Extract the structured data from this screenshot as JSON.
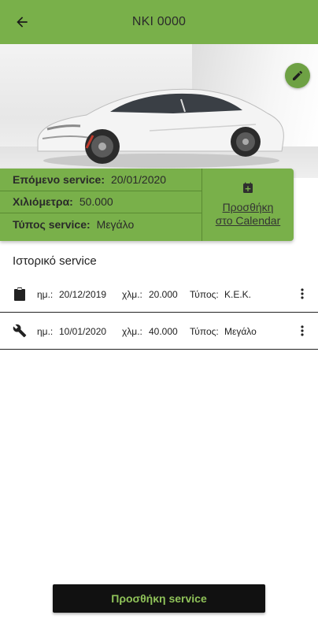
{
  "appbar": {
    "title": "NKI 0000"
  },
  "colors": {
    "accent": "#79b04a",
    "button_bg": "#111111",
    "button_text": "#8fc259"
  },
  "next_service": {
    "date_label": "Επόμενο service:",
    "date_value": "20/01/2020",
    "km_label": "Χιλιόμετρα:",
    "km_value": "50.000",
    "type_label": "Τύπος service:",
    "type_value": "Μεγάλο",
    "calendar_line1": "Προσθήκη",
    "calendar_line2": "στο Calendar"
  },
  "history": {
    "title": "Ιστορικό service",
    "items": [
      {
        "icon": "clipboard-icon",
        "date_label": "ημ.:",
        "date": "20/12/2019",
        "km_label": "χλμ.:",
        "km": "20.000",
        "type_label": "Τύπος:",
        "type": "Κ.Ε.Κ."
      },
      {
        "icon": "wrench-icon",
        "date_label": "ημ.:",
        "date": "10/01/2020",
        "km_label": "χλμ.:",
        "km": "40.000",
        "type_label": "Τύπος:",
        "type": "Μεγάλο"
      }
    ]
  },
  "actions": {
    "add_service": "Προσθήκη service"
  }
}
